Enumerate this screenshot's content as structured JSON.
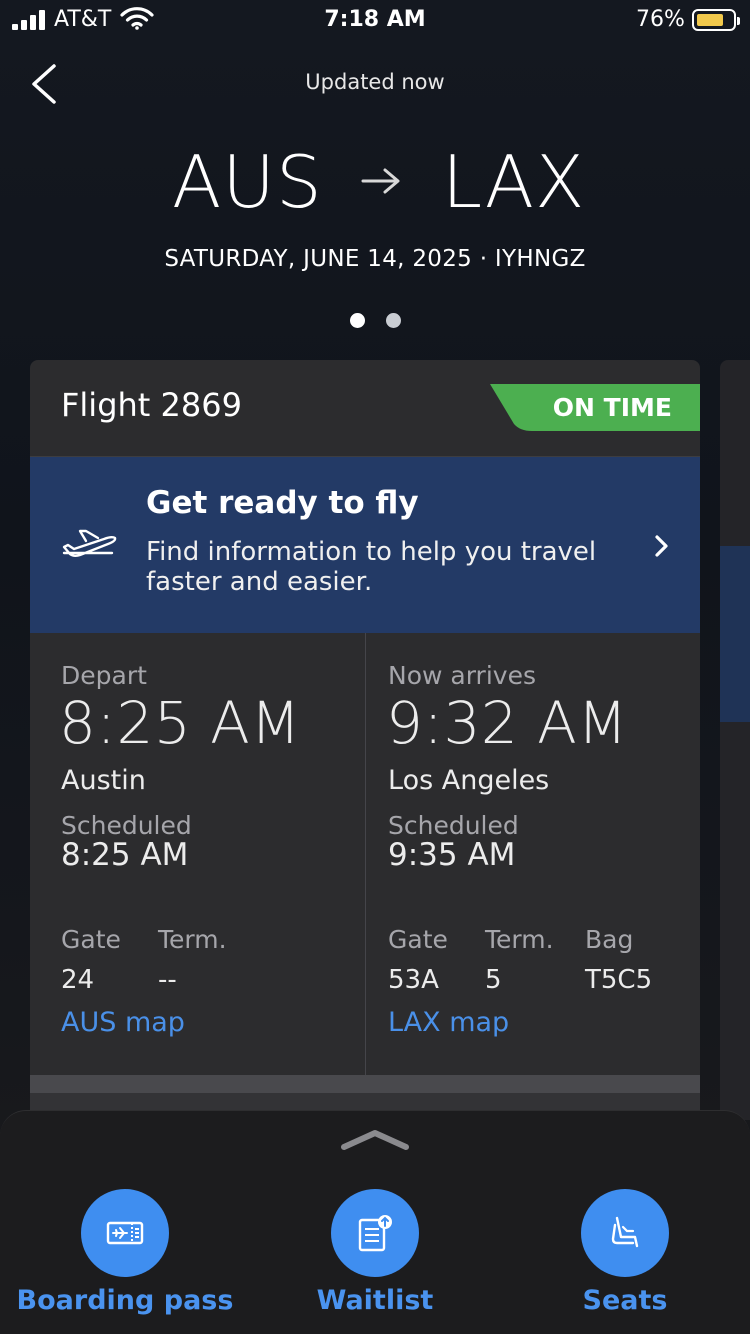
{
  "status_bar": {
    "carrier": "AT&T",
    "time": "7:18 AM",
    "battery_percent": "76%",
    "battery_level": 0.76,
    "signal_bars": 4,
    "battery_color": "#f2c94c"
  },
  "header": {
    "back_icon": "chevron-left-icon",
    "updated_text": "Updated now",
    "origin": "AUS",
    "destination": "LAX",
    "route_arrow_icon": "arrow-right-icon",
    "date_line": "SATURDAY, JUNE 14, 2025 · IYHNGZ",
    "page_dots": {
      "count": 2,
      "active_index": 0
    }
  },
  "card": {
    "flight_label": "Flight 2869",
    "status": "ON TIME",
    "status_color": "#4caf50",
    "promo": {
      "icon": "airplane-takeoff-icon",
      "title": "Get ready to fly",
      "description": "Find information to help you travel faster and easier.",
      "chevron_icon": "chevron-right-icon",
      "background": "#233a66"
    },
    "depart": {
      "label": "Depart",
      "time": "8:25 AM",
      "city": "Austin",
      "scheduled_label": "Scheduled",
      "scheduled_time": "8:25 AM",
      "gate_label": "Gate",
      "gate": "24",
      "term_label": "Term.",
      "term": "--",
      "map_link": "AUS map"
    },
    "arrive": {
      "label": "Now arrives",
      "time": "9:32 AM",
      "city": "Los Angeles",
      "scheduled_label": "Scheduled",
      "scheduled_time": "9:35 AM",
      "gate_label": "Gate",
      "gate": "53A",
      "term_label": "Term.",
      "term": "5",
      "bag_label": "Bag",
      "bag": "T5C5",
      "map_link": "LAX map"
    }
  },
  "bottom_sheet": {
    "handle_icon": "chevron-up-icon",
    "actions": [
      {
        "label": "Boarding pass",
        "icon": "boarding-pass-icon"
      },
      {
        "label": "Waitlist",
        "icon": "waitlist-icon"
      },
      {
        "label": "Seats",
        "icon": "seat-icon"
      }
    ],
    "accent": "#3f8ef0"
  }
}
